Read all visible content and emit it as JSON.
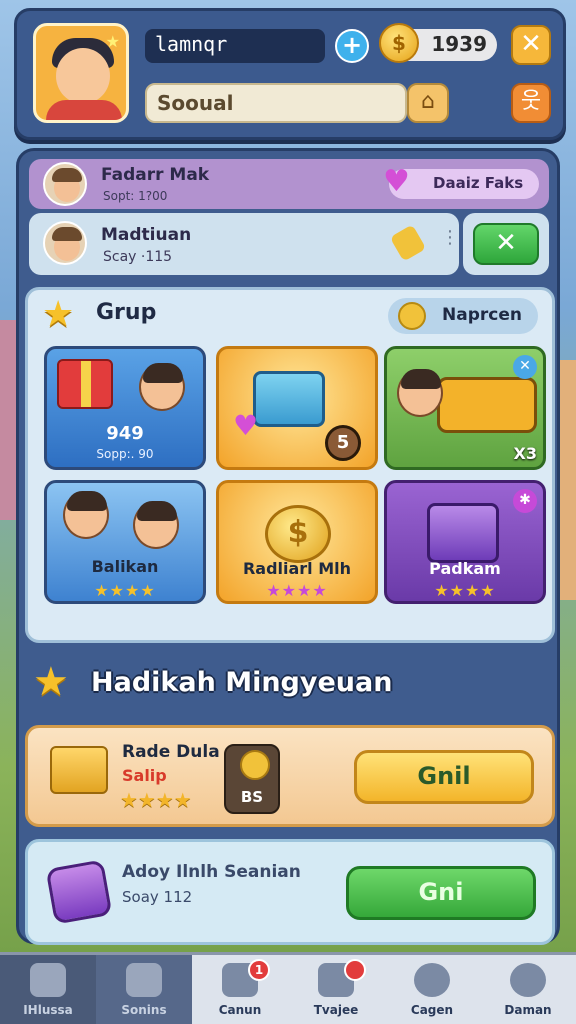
{
  "header": {
    "username": "lamnqr",
    "coins": "1939",
    "search_value": "Sooual"
  },
  "friends": [
    {
      "name": "Fadarr Mak",
      "sub": "Sopt: 1?00",
      "badge": "Daaiz Faks"
    },
    {
      "name": "Madtiuan",
      "sub": "Scay ·115"
    }
  ],
  "grup": {
    "title": "Grup",
    "badge": "Naprcen",
    "cards": [
      {
        "label": "949",
        "sub": "Sopp:. 90"
      },
      {
        "label": "",
        "key_count": "5"
      },
      {
        "label": "",
        "mult": "X3"
      },
      {
        "label": "Balikan",
        "stars": "★★★★"
      },
      {
        "label": "Radliarl Mlh",
        "stars": "★★★★"
      },
      {
        "label": "Padkam",
        "stars": "★★★★"
      }
    ]
  },
  "rewards": {
    "title": "Hadikah Mingyeuan",
    "items": [
      {
        "name": "Rade Dula",
        "tag": "Salip",
        "stars": "★★★★",
        "cost": "BS",
        "button": "Gnil"
      },
      {
        "name": "Adoy Ilnlh Seanian",
        "sub": "Soay 112",
        "button": "Gni"
      }
    ]
  },
  "nav": [
    {
      "label": "IHlussa",
      "icon": "home-icon"
    },
    {
      "label": "Sonins",
      "icon": "phone-icon"
    },
    {
      "label": "Canun",
      "icon": "chat-icon",
      "badge": "1"
    },
    {
      "label": "Tvajee",
      "icon": "shield-icon",
      "badge": ""
    },
    {
      "label": "Cagen",
      "icon": "globe-icon"
    },
    {
      "label": "Daman",
      "icon": "profile-icon"
    }
  ],
  "colors": {
    "accent": "#3c5a8e",
    "gold": "#f3b52a",
    "green": "#35a83a"
  }
}
